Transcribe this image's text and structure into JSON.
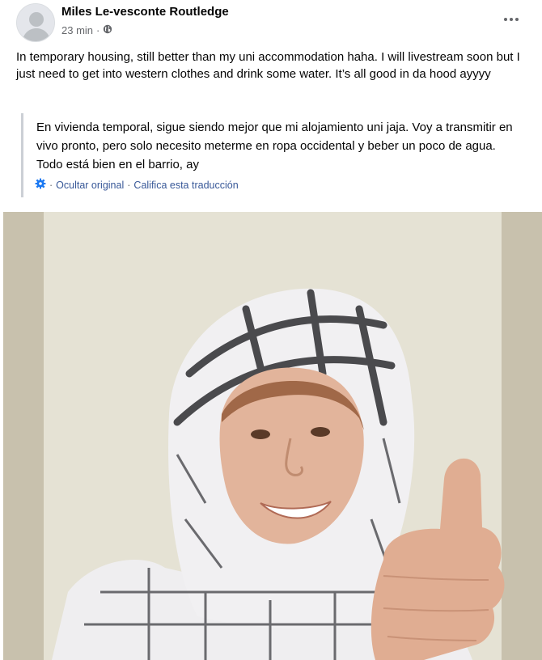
{
  "post": {
    "author": "Miles Le-vesconte Routledge",
    "time": "23 min",
    "separator": "·",
    "privacy_icon": "globe-icon",
    "more_icon": "more-options-icon",
    "text": "In temporary housing, still better than my uni accommodation haha. I will livestream soon but I just need to get into western clothes and drink some water. It’s all good in da hood ayyyy"
  },
  "translation": {
    "text": "En vivienda temporal, sigue siendo mejor que mi alojamiento uni jaja. Voy a transmitir en vivo pronto, pero solo necesito meterme en ropa occidental y beber un poco de agua. Todo está bien en el barrio, ay",
    "settings_icon": "gear-icon",
    "hide_label": "Ocultar original",
    "rate_label": "Califica esta traducción",
    "link_separator": "·"
  },
  "photo": {
    "subject": "selfie-photo"
  },
  "colors": {
    "link": "#385898",
    "secondary_text": "#65676b",
    "photo_wall": "#e6e3d6"
  }
}
